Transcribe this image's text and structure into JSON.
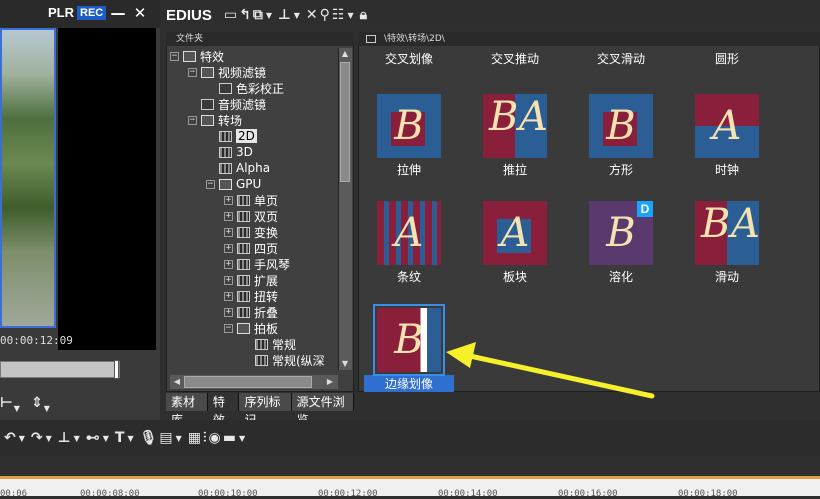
{
  "player": {
    "plr": "PLR",
    "rec": "REC",
    "timecode": "00:00:12:09",
    "min_btn": "—",
    "close_btn": "✕"
  },
  "app": {
    "name": "EDIUS"
  },
  "tree": {
    "header": "文件夹",
    "items": [
      {
        "label": "特效",
        "pm": "−"
      },
      {
        "label": "视频滤镜",
        "pm": "−"
      },
      {
        "label": "色彩校正",
        "pm": ""
      },
      {
        "label": "音频滤镜",
        "pm": ""
      },
      {
        "label": "转场",
        "pm": "−"
      },
      {
        "label": "2D",
        "pm": ""
      },
      {
        "label": "3D",
        "pm": ""
      },
      {
        "label": "Alpha",
        "pm": ""
      },
      {
        "label": "GPU",
        "pm": "−"
      },
      {
        "label": "单页",
        "pm": "+"
      },
      {
        "label": "双页",
        "pm": "+"
      },
      {
        "label": "变换",
        "pm": "+"
      },
      {
        "label": "四页",
        "pm": "+"
      },
      {
        "label": "手风琴",
        "pm": "+"
      },
      {
        "label": "扩展",
        "pm": "+"
      },
      {
        "label": "扭转",
        "pm": "+"
      },
      {
        "label": "折叠",
        "pm": "+"
      },
      {
        "label": "拍板",
        "pm": "−"
      },
      {
        "label": "常规",
        "pm": ""
      },
      {
        "label": "常规(纵深",
        "pm": ""
      }
    ]
  },
  "tabs": [
    "素材库",
    "特效",
    "序列标记",
    "源文件浏览"
  ],
  "path": "\\特效\\转场\\2D\\",
  "effects": [
    "交叉划像",
    "交叉推动",
    "交叉滑动",
    "圆形",
    "拉伸",
    "推拉",
    "方形",
    "时钟",
    "条纹",
    "板块",
    "溶化",
    "滑动",
    "边缘划像"
  ],
  "badge": "D",
  "thumb_letters": {
    "a": "A",
    "b": "B"
  },
  "ruler": [
    "00:06",
    "00:00:08:00",
    "00:00:10:00",
    "00:00:12:00",
    "00:00:14:00",
    "00:00:16:00",
    "00:00:18:00"
  ],
  "colors": {
    "arrow": "#f5f02a",
    "selection": "#2f6fd0",
    "thumb_red": "#8a1f3c",
    "thumb_blue": "#2a5e95"
  }
}
